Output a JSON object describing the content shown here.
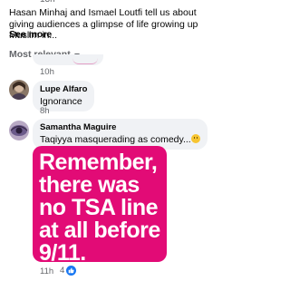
{
  "post": {
    "time_fragment": "13h",
    "text": "Hasan Minhaj and Ismael Loutfi tell us about giving audiences a glimpse of life growing up Muslim in...",
    "see_more_label": "See more"
  },
  "comments_header": {
    "sort_label": "Most relevant"
  },
  "comments": [
    {
      "time": "10h"
    },
    {
      "author": "Lupe Alfaro",
      "text": "Ignorance",
      "time": "8h"
    },
    {
      "author": "Samantha Maguire",
      "text": "Taqiyya masquerading as comedy...",
      "time": "11h",
      "likes": "4",
      "meme_text_lines": [
        "Remember,",
        "there was",
        "no TSA line",
        "at all before",
        "9/11."
      ]
    }
  ],
  "colors": {
    "meme_bg": "#e20b76",
    "like_blue": "#1877f2",
    "bubble_bg": "#f0f2f5"
  },
  "icons": {
    "sort": "chevron-down-icon",
    "like": "thumbs-up-icon",
    "emoji": "smiley-icon"
  }
}
